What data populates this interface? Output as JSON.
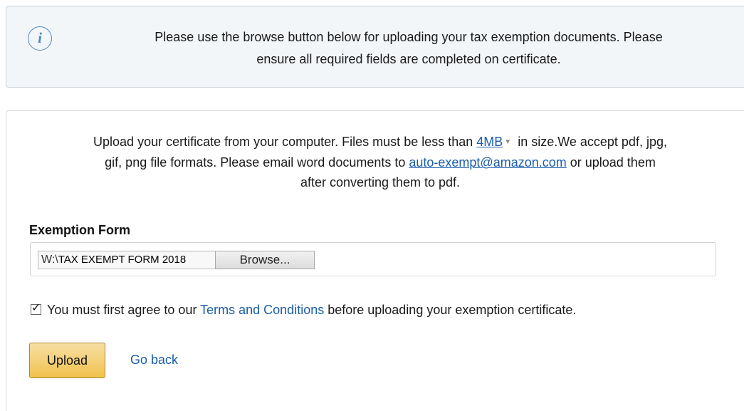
{
  "info": {
    "icon": "info-icon",
    "icon_glyph": "i",
    "line1": "Please use the browse button below for uploading your tax exemption documents. Please",
    "line2": "ensure all required fields are completed on certificate."
  },
  "intro": {
    "line1_prefix": "Upload your certificate from your computer. Files must be less than ",
    "size_link": "4MB",
    "line1_suffix": " in size.We accept pdf, jpg,",
    "line2_prefix": "gif, png file formats. Please email word documents to ",
    "email_link": "auto-exempt@amazon.com",
    "line2_suffix": " or upload them",
    "line3": "after converting them to pdf."
  },
  "form": {
    "label": "Exemption Form",
    "file_path_prefix": "W:\\",
    "file_name": "TAX EXEMPT  FORM 2018",
    "browse_label": "Browse..."
  },
  "agree": {
    "checked": true,
    "prefix": "You must first agree to our ",
    "terms_link": "Terms and Conditions",
    "suffix": " before uploading your exemption certificate."
  },
  "actions": {
    "upload_label": "Upload",
    "go_back_label": "Go back"
  },
  "colors": {
    "link": "#1a5dab",
    "upload_button": "#f0c14b",
    "info_icon": "#4f87c0",
    "info_background": "#f3f6f9"
  }
}
